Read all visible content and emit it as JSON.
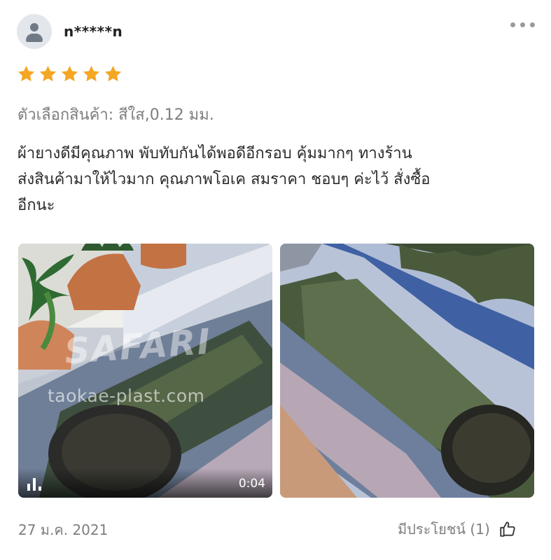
{
  "review": {
    "username": "n*****n",
    "rating": 5,
    "star_color": "#f5a623",
    "variation": "ตัวเลือกสินค้า: สีใส,0.12 มม.",
    "comment_lines": [
      "ผ้ายางดีมีคุณภาพ พับทับกันได้พอดีอีกรอบ คุ้มมากๆ ทางร้าน",
      "ส่งสินค้ามาให้ไวมาก คุณภาพโอเค สมราคา ชอบๆ ค่ะไว้ สั่งซื้อ",
      "อีกนะ"
    ],
    "media": [
      {
        "type": "video",
        "duration": "0:04",
        "watermark_brand": "SAFARI",
        "watermark_site": "taokae-plast.com",
        "icon": "video-bars-icon"
      },
      {
        "type": "image"
      }
    ],
    "date": "27 ม.ค. 2021",
    "helpful_label": "มีประโยชน์ (1)",
    "icons": {
      "avatar": "user-avatar-icon",
      "more": "more-dots-icon",
      "helpful": "thumbs-up-icon"
    }
  }
}
